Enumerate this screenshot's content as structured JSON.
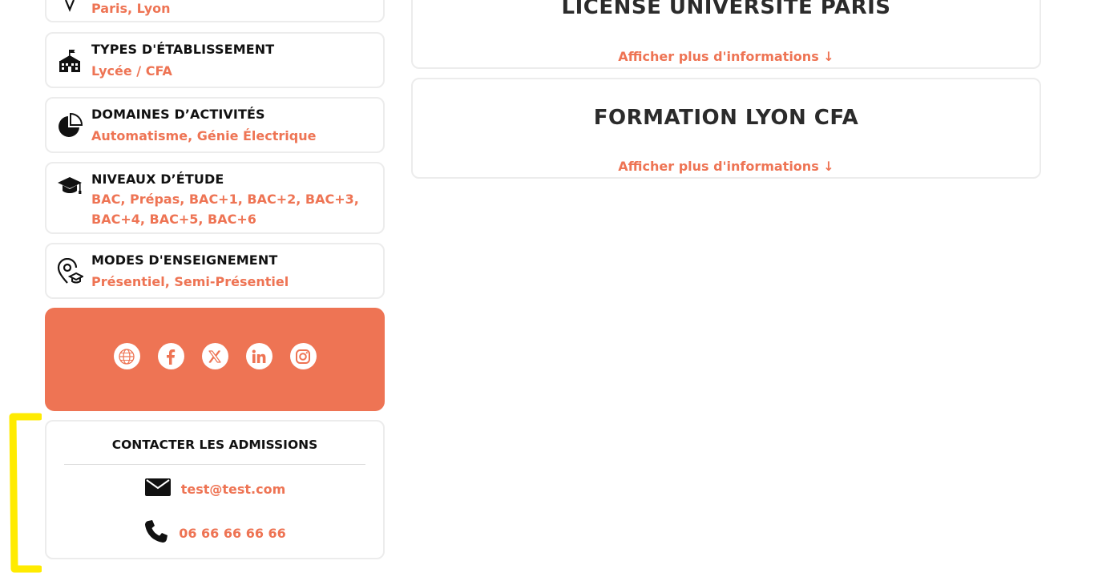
{
  "left": {
    "location_card": {
      "value": "Paris, Lyon",
      "icon": "map-pin-icon"
    },
    "info_cards": [
      {
        "title": "TYPES D'ÉTABLISSEMENT",
        "value": "Lycée / CFA",
        "icon": "school-building-icon"
      },
      {
        "title": "DOMAINES D’ACTIVITÉS",
        "value": "Automatisme, Génie Électrique",
        "icon": "pie-chart-icon"
      },
      {
        "title": "NIVEAUX D’ÉTUDE",
        "value": "BAC, Prépas, BAC+1, BAC+2, BAC+3, BAC+4, BAC+5, BAC+6",
        "icon": "graduation-cap-icon"
      },
      {
        "title": "MODES D'ENSEIGNEMENT",
        "value": "Présentiel, Semi-Présentiel",
        "icon": "location-graduation-icon"
      }
    ],
    "social": {
      "background": "#ee7454",
      "links": [
        "website-icon",
        "facebook-icon",
        "x-twitter-icon",
        "linkedin-icon",
        "instagram-icon"
      ]
    },
    "contact": {
      "title": "CONTACTER LES ADMISSIONS",
      "email": "test@test.com",
      "phone": "06 66 66 66 66"
    }
  },
  "right": {
    "formations": [
      {
        "title": "LICENSE UNIVERSITE PARIS",
        "more": "Afficher plus d'informations ↓"
      },
      {
        "title": "FORMATION LYON CFA",
        "more": "Afficher plus d'informations ↓"
      }
    ]
  },
  "colors": {
    "accent": "#ee7454",
    "highlight": "#ffeb00"
  }
}
